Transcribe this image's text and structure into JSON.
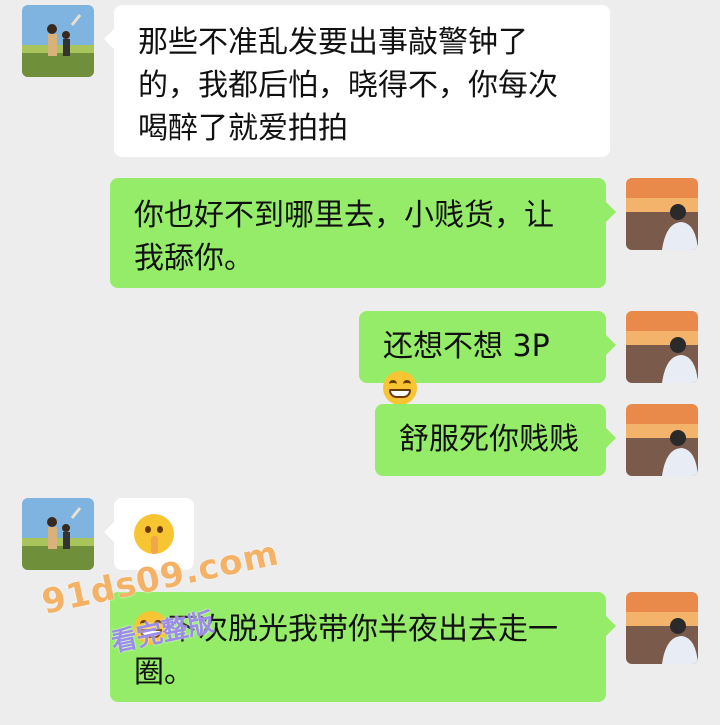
{
  "messages": [
    {
      "side": "in",
      "text": "那些不准乱发要出事敲警钟了的，我都后怕，晓得不，你每次喝醉了就爱拍拍"
    },
    {
      "side": "out",
      "text": "你也好不到哪里去，小贱货，让我舔你。"
    },
    {
      "side": "out",
      "text": "还想不想 3P",
      "emoji": "grin-emoji"
    },
    {
      "side": "out",
      "text": "舒服死你贱贱"
    },
    {
      "side": "in",
      "text": "",
      "emoji": "shush-emoji"
    },
    {
      "side": "out",
      "text": "下次脱光我带你半夜出去走一圈。",
      "emoji": "grin-emoji"
    }
  ],
  "watermark": {
    "site": "91ds09.com",
    "caption": "看完整版"
  },
  "colors": {
    "background": "#ededed",
    "incoming": "#ffffff",
    "outgoing": "#95ec69"
  }
}
